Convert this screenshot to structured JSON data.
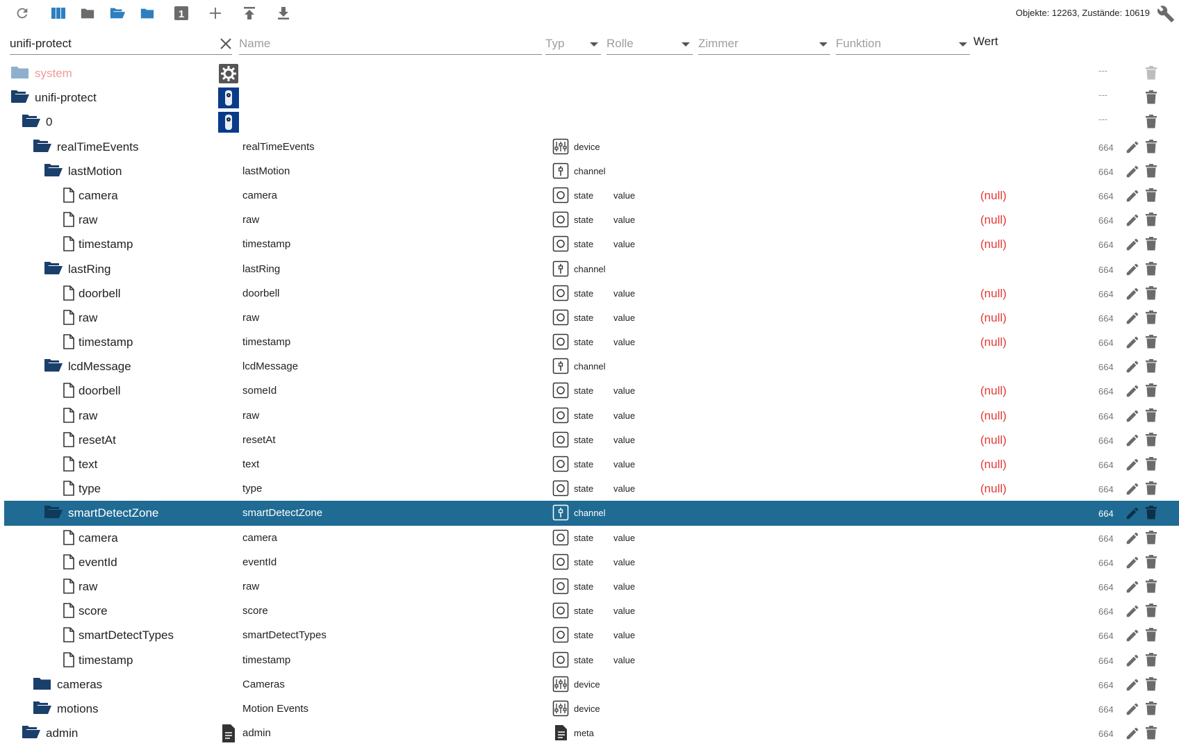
{
  "toolbar": {
    "buttons": [
      {
        "name": "refresh-icon",
        "label": "Refresh"
      },
      {
        "name": "columns-icon",
        "label": "Columns"
      },
      {
        "name": "folder-closed-icon",
        "label": "Collapse"
      },
      {
        "name": "folder-open-icon",
        "label": "Expand"
      },
      {
        "name": "folder-blue-icon",
        "label": "Folder"
      },
      {
        "name": "level-one-icon",
        "label": "1"
      },
      {
        "name": "plus-icon",
        "label": "Add"
      },
      {
        "name": "upload-icon",
        "label": "Upload"
      },
      {
        "name": "download-icon",
        "label": "Download"
      }
    ],
    "counts": "Objekte: 12263, Zustände: 10619"
  },
  "filters": {
    "id_value": "unifi-protect",
    "name_placeholder": "Name",
    "typ_placeholder": "Typ",
    "rolle_placeholder": "Rolle",
    "zimmer_placeholder": "Zimmer",
    "funktion_placeholder": "Funktion",
    "wert_header": "Wert"
  },
  "colors": {
    "folder_dark": "#1a3f6b",
    "folder_light": "#2f7fbf",
    "selected_row": "#1f6b93",
    "null_value": "#e53935",
    "disabled_label": "#f19a9a"
  },
  "rows": [
    {
      "indent": 0,
      "icon": "folder-closed",
      "label": "system",
      "name": "",
      "typ": "",
      "typ_icon": "",
      "rolle": "",
      "wert": "",
      "acl": "---",
      "edit": false,
      "fnicon": "gear",
      "dim": true
    },
    {
      "indent": 0,
      "icon": "folder-open",
      "label": "unifi-protect",
      "name": "",
      "typ": "",
      "typ_icon": "",
      "rolle": "",
      "wert": "",
      "acl": "---",
      "edit": false,
      "fnicon": "camera"
    },
    {
      "indent": 1,
      "icon": "folder-open",
      "label": "0",
      "name": "",
      "typ": "",
      "typ_icon": "",
      "rolle": "",
      "wert": "",
      "acl": "---",
      "edit": false,
      "fnicon": "camera"
    },
    {
      "indent": 2,
      "icon": "folder-open",
      "label": "realTimeEvents",
      "name": "realTimeEvents",
      "typ": "device",
      "typ_icon": "device",
      "rolle": "",
      "wert": "",
      "acl": "664",
      "edit": true
    },
    {
      "indent": 3,
      "icon": "folder-open",
      "label": "lastMotion",
      "name": "lastMotion",
      "typ": "channel",
      "typ_icon": "channel",
      "rolle": "",
      "wert": "",
      "acl": "664",
      "edit": true
    },
    {
      "indent": 4,
      "icon": "file",
      "label": "camera",
      "name": "camera",
      "typ": "state",
      "typ_icon": "state",
      "rolle": "value",
      "wert": "(null)",
      "acl": "664",
      "edit": true
    },
    {
      "indent": 4,
      "icon": "file",
      "label": "raw",
      "name": "raw",
      "typ": "state",
      "typ_icon": "state",
      "rolle": "value",
      "wert": "(null)",
      "acl": "664",
      "edit": true
    },
    {
      "indent": 4,
      "icon": "file",
      "label": "timestamp",
      "name": "timestamp",
      "typ": "state",
      "typ_icon": "state",
      "rolle": "value",
      "wert": "(null)",
      "acl": "664",
      "edit": true
    },
    {
      "indent": 3,
      "icon": "folder-open",
      "label": "lastRing",
      "name": "lastRing",
      "typ": "channel",
      "typ_icon": "channel",
      "rolle": "",
      "wert": "",
      "acl": "664",
      "edit": true
    },
    {
      "indent": 4,
      "icon": "file",
      "label": "doorbell",
      "name": "doorbell",
      "typ": "state",
      "typ_icon": "state",
      "rolle": "value",
      "wert": "(null)",
      "acl": "664",
      "edit": true
    },
    {
      "indent": 4,
      "icon": "file",
      "label": "raw",
      "name": "raw",
      "typ": "state",
      "typ_icon": "state",
      "rolle": "value",
      "wert": "(null)",
      "acl": "664",
      "edit": true
    },
    {
      "indent": 4,
      "icon": "file",
      "label": "timestamp",
      "name": "timestamp",
      "typ": "state",
      "typ_icon": "state",
      "rolle": "value",
      "wert": "(null)",
      "acl": "664",
      "edit": true
    },
    {
      "indent": 3,
      "icon": "folder-open",
      "label": "lcdMessage",
      "name": "lcdMessage",
      "typ": "channel",
      "typ_icon": "channel",
      "rolle": "",
      "wert": "",
      "acl": "664",
      "edit": true
    },
    {
      "indent": 4,
      "icon": "file",
      "label": "doorbell",
      "name": "someId",
      "typ": "state",
      "typ_icon": "state",
      "rolle": "value",
      "wert": "(null)",
      "acl": "664",
      "edit": true
    },
    {
      "indent": 4,
      "icon": "file",
      "label": "raw",
      "name": "raw",
      "typ": "state",
      "typ_icon": "state",
      "rolle": "value",
      "wert": "(null)",
      "acl": "664",
      "edit": true
    },
    {
      "indent": 4,
      "icon": "file",
      "label": "resetAt",
      "name": "resetAt",
      "typ": "state",
      "typ_icon": "state",
      "rolle": "value",
      "wert": "(null)",
      "acl": "664",
      "edit": true
    },
    {
      "indent": 4,
      "icon": "file",
      "label": "text",
      "name": "text",
      "typ": "state",
      "typ_icon": "state",
      "rolle": "value",
      "wert": "(null)",
      "acl": "664",
      "edit": true
    },
    {
      "indent": 4,
      "icon": "file",
      "label": "type",
      "name": "type",
      "typ": "state",
      "typ_icon": "state",
      "rolle": "value",
      "wert": "(null)",
      "acl": "664",
      "edit": true
    },
    {
      "indent": 3,
      "icon": "folder-open",
      "label": "smartDetectZone",
      "name": "smartDetectZone",
      "typ": "channel",
      "typ_icon": "channel",
      "rolle": "",
      "wert": "",
      "acl": "664",
      "edit": true,
      "selected": true
    },
    {
      "indent": 4,
      "icon": "file",
      "label": "camera",
      "name": "camera",
      "typ": "state",
      "typ_icon": "state",
      "rolle": "value",
      "wert": "",
      "acl": "664",
      "edit": true
    },
    {
      "indent": 4,
      "icon": "file",
      "label": "eventId",
      "name": "eventId",
      "typ": "state",
      "typ_icon": "state",
      "rolle": "value",
      "wert": "",
      "acl": "664",
      "edit": true
    },
    {
      "indent": 4,
      "icon": "file",
      "label": "raw",
      "name": "raw",
      "typ": "state",
      "typ_icon": "state",
      "rolle": "value",
      "wert": "",
      "acl": "664",
      "edit": true
    },
    {
      "indent": 4,
      "icon": "file",
      "label": "score",
      "name": "score",
      "typ": "state",
      "typ_icon": "state",
      "rolle": "value",
      "wert": "",
      "acl": "664",
      "edit": true
    },
    {
      "indent": 4,
      "icon": "file",
      "label": "smartDetectTypes",
      "name": "smartDetectTypes",
      "typ": "state",
      "typ_icon": "state",
      "rolle": "value",
      "wert": "",
      "acl": "664",
      "edit": true
    },
    {
      "indent": 4,
      "icon": "file",
      "label": "timestamp",
      "name": "timestamp",
      "typ": "state",
      "typ_icon": "state",
      "rolle": "value",
      "wert": "",
      "acl": "664",
      "edit": true
    },
    {
      "indent": 2,
      "icon": "folder-closed",
      "label": "cameras",
      "name": "Cameras",
      "typ": "device",
      "typ_icon": "device",
      "rolle": "",
      "wert": "",
      "acl": "664",
      "edit": true
    },
    {
      "indent": 2,
      "icon": "folder-open",
      "label": "motions",
      "name": "Motion Events",
      "typ": "device",
      "typ_icon": "device",
      "rolle": "",
      "wert": "",
      "acl": "664",
      "edit": true
    },
    {
      "indent": 1,
      "icon": "folder-open",
      "label": "admin",
      "name": "admin",
      "typ": "meta",
      "typ_icon": "meta",
      "rolle": "",
      "wert": "",
      "acl": "664",
      "edit": true,
      "fnicon": "doc"
    }
  ]
}
